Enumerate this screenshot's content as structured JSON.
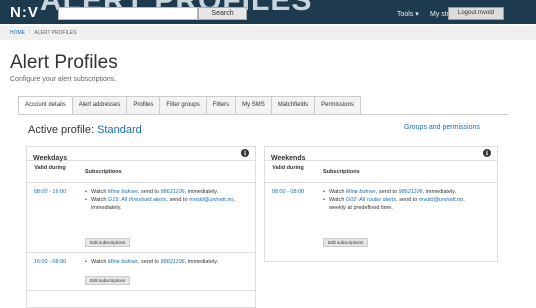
{
  "header": {
    "logo": "N:V",
    "banner_text_left": "ALERT PROFILES",
    "banner_text_right": "s",
    "search_placeholder": "",
    "search_button": "Search",
    "tools_label": "Tools",
    "mystuff_label": "My stuff",
    "logout_label": "Logout mvold"
  },
  "breadcrumb": {
    "home": "HOME",
    "current": "ALERT PROFILES"
  },
  "page": {
    "title": "Alert Profiles",
    "subtitle": "Configure your alert subscriptions."
  },
  "tabs": [
    "Account details",
    "Alert addresses",
    "Profiles",
    "Filter groups",
    "Filters",
    "My SMS",
    "Matchfields",
    "Permissions"
  ],
  "active_profile": {
    "label": "Active profile:",
    "name": "Standard"
  },
  "groups_link": "Groups and permissions",
  "weekdays": {
    "title": "Weekdays",
    "col_valid": "Valid during",
    "col_subs": "Subscriptions",
    "rows": [
      {
        "time": "08:00 - 16:00",
        "subs": [
          {
            "pre": "Watch ",
            "filter": "Mine bokser",
            "mid": ", send to ",
            "address": "98621106",
            "post": ", immediately."
          },
          {
            "pre": "Watch ",
            "filter": "G15: All threshold alerts",
            "mid": ", send to ",
            "address": "mvold@uninett.no",
            "post": ", immediately."
          }
        ],
        "edit": "Edit subscriptions"
      },
      {
        "time": "16:00 - 08:00",
        "subs": [
          {
            "pre": "Watch ",
            "filter": "Mine bokser",
            "mid": ", send to ",
            "address": "98621106",
            "post": ", immediately."
          }
        ],
        "edit": "Edit subscriptions"
      }
    ]
  },
  "weekends": {
    "title": "Weekends",
    "col_valid": "Valid during",
    "col_subs": "Subscriptions",
    "rows": [
      {
        "time": "08:00 - 08:00",
        "subs": [
          {
            "pre": "Watch ",
            "filter": "Mine bokser",
            "mid": ", send to ",
            "address": "98621106",
            "post": ", immediately."
          },
          {
            "pre": "Watch ",
            "filter": "G02: All router alerts",
            "mid": ", send to ",
            "address": "mvold@uninett.no",
            "post": ", weekly at predefined time."
          }
        ],
        "edit": "Edit subscriptions"
      }
    ]
  },
  "icons": {
    "info": "info-icon",
    "dropdown": "chevron-down-icon"
  },
  "colors": {
    "banner": "#1e3a4e",
    "link": "#1a6eb5"
  }
}
